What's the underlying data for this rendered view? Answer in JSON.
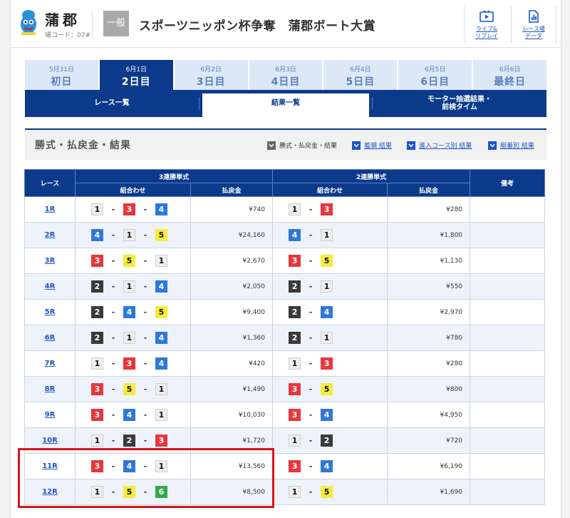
{
  "header": {
    "venue": "蒲郡",
    "venue_code": "場コード：07#",
    "grade": "一般",
    "race_title": "スポーツニッポン杯争奪　蒲郡ボート大賞",
    "buttons": [
      {
        "label1": "ライブ&",
        "label2": "リプレイ",
        "icon": "play-icon"
      },
      {
        "label1": "レース場",
        "label2": "データ",
        "icon": "data-icon"
      }
    ]
  },
  "days": [
    {
      "date": "5月31日",
      "name": "初日",
      "active": false
    },
    {
      "date": "6月1日",
      "name": "2日目",
      "active": true
    },
    {
      "date": "6月2日",
      "name": "3日目",
      "active": false
    },
    {
      "date": "6月3日",
      "name": "4日目",
      "active": false
    },
    {
      "date": "6月4日",
      "name": "5日目",
      "active": false
    },
    {
      "date": "6月5日",
      "name": "6日目",
      "active": false
    },
    {
      "date": "6月6日",
      "name": "最終日",
      "active": false
    }
  ],
  "subtabs": {
    "race_list": "レース一覧",
    "results_list": "結果一覧",
    "motor_line1": "モーター抽選結果・",
    "motor_line2": "前検タイム"
  },
  "section": {
    "title": "勝式・払戻金・結果",
    "filters": [
      "勝式・払戻金・結果",
      "着順 結果",
      "進入コース別 結果",
      "艇番別 結果"
    ]
  },
  "table": {
    "col_race": "レース",
    "col_trifecta": "3連勝単式",
    "col_exacta": "2連勝単式",
    "col_notes": "備考",
    "col_combo": "組合わせ",
    "col_payout": "払戻金",
    "rows": [
      {
        "race": "1R",
        "tri": [
          1,
          3,
          4
        ],
        "tri_pay": "¥740",
        "ex": [
          1,
          3
        ],
        "ex_pay": "¥280"
      },
      {
        "race": "2R",
        "tri": [
          4,
          1,
          5
        ],
        "tri_pay": "¥24,160",
        "ex": [
          4,
          1
        ],
        "ex_pay": "¥1,800"
      },
      {
        "race": "3R",
        "tri": [
          3,
          5,
          1
        ],
        "tri_pay": "¥2,670",
        "ex": [
          3,
          5
        ],
        "ex_pay": "¥1,130"
      },
      {
        "race": "4R",
        "tri": [
          2,
          1,
          4
        ],
        "tri_pay": "¥2,050",
        "ex": [
          2,
          1
        ],
        "ex_pay": "¥550"
      },
      {
        "race": "5R",
        "tri": [
          2,
          4,
          5
        ],
        "tri_pay": "¥9,400",
        "ex": [
          2,
          4
        ],
        "ex_pay": "¥2,970"
      },
      {
        "race": "6R",
        "tri": [
          2,
          1,
          4
        ],
        "tri_pay": "¥1,360",
        "ex": [
          2,
          1
        ],
        "ex_pay": "¥780"
      },
      {
        "race": "7R",
        "tri": [
          1,
          3,
          4
        ],
        "tri_pay": "¥420",
        "ex": [
          1,
          3
        ],
        "ex_pay": "¥280"
      },
      {
        "race": "8R",
        "tri": [
          3,
          5,
          1
        ],
        "tri_pay": "¥1,490",
        "ex": [
          3,
          5
        ],
        "ex_pay": "¥800"
      },
      {
        "race": "9R",
        "tri": [
          3,
          4,
          1
        ],
        "tri_pay": "¥10,030",
        "ex": [
          3,
          4
        ],
        "ex_pay": "¥4,950"
      },
      {
        "race": "10R",
        "tri": [
          1,
          2,
          3
        ],
        "tri_pay": "¥1,720",
        "ex": [
          1,
          2
        ],
        "ex_pay": "¥720"
      },
      {
        "race": "11R",
        "tri": [
          3,
          4,
          1
        ],
        "tri_pay": "¥13,560",
        "ex": [
          3,
          4
        ],
        "ex_pay": "¥6,190"
      },
      {
        "race": "12R",
        "tri": [
          1,
          5,
          6
        ],
        "tri_pay": "¥8,500",
        "ex": [
          1,
          5
        ],
        "ex_pay": "¥1,690"
      }
    ]
  },
  "colors": {
    "navy": "#0b3a8b",
    "highlight_border": "#d8151b",
    "boat1": "#eeeeee",
    "boat2": "#3a3a3a",
    "boat3": "#e8373c",
    "boat4": "#2f78d8",
    "boat5": "#f6ec3c",
    "boat6": "#34a84b"
  }
}
